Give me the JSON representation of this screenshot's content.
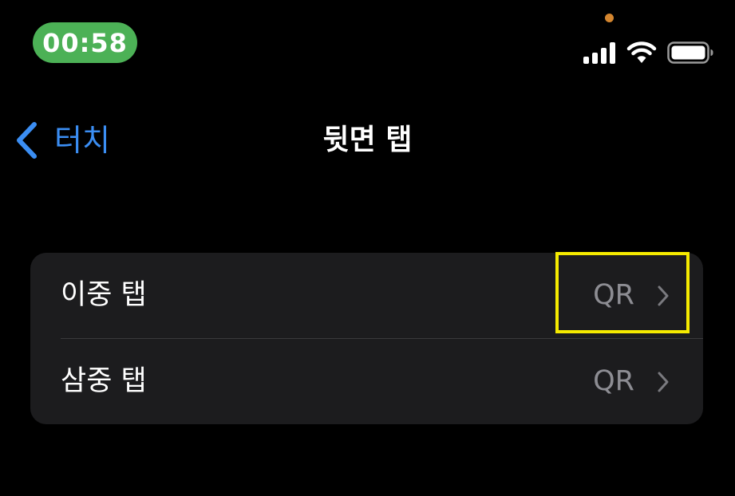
{
  "status_bar": {
    "time": "00:58",
    "time_pill_color": "#4cb156",
    "privacy_dot_color": "#d4862f",
    "icons": [
      "signal-icon",
      "wifi-icon",
      "battery-icon"
    ]
  },
  "nav": {
    "back_label": "터치",
    "back_icon": "chevron-left-icon",
    "title": "뒷면 탭",
    "accent_color": "#3b8ef3"
  },
  "settings": {
    "rows": [
      {
        "label": "이중 탭",
        "value": "QR",
        "icon": "chevron-right-icon"
      },
      {
        "label": "삼중 탭",
        "value": "QR",
        "icon": "chevron-right-icon"
      }
    ]
  },
  "highlight": {
    "target": "settings.rows.0.value",
    "color": "#f5ea00"
  }
}
